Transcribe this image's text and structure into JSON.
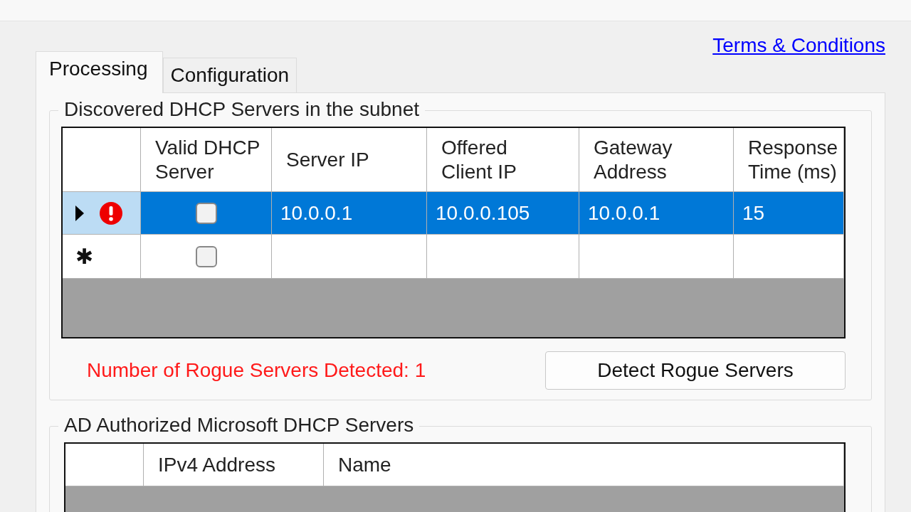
{
  "link": "Terms & Conditions",
  "tabs": [
    {
      "label": "Processing",
      "selected": true
    },
    {
      "label": "Configuration",
      "selected": false
    }
  ],
  "discovered": {
    "title": "Discovered DHCP Servers in the subnet",
    "columns": [
      "Valid DHCP\nServer",
      "Server IP",
      "Offered\nClient IP",
      "Gateway\nAddress",
      "Response\nTime (ms)"
    ],
    "rows": [
      {
        "kind": "data",
        "current": true,
        "error": true,
        "selected": true,
        "valid": false,
        "cells": [
          "10.0.0.1",
          "10.0.0.105",
          "10.0.0.1",
          "15"
        ]
      },
      {
        "kind": "new",
        "marker": "✱",
        "current": false,
        "error": false,
        "selected": false,
        "valid": false
      }
    ],
    "rogue_count": "Number of Rogue Servers Detected: 1",
    "detect_button": "Detect Rogue Servers"
  },
  "authorized": {
    "title": "AD Authorized Microsoft DHCP Servers",
    "columns": [
      "IPv4 Address",
      "Name"
    ]
  }
}
